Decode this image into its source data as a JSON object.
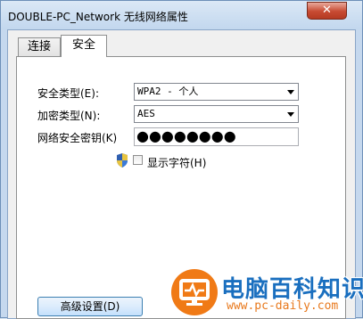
{
  "window": {
    "title": "DOUBLE-PC_Network 无线网络属性",
    "close_symbol": "✕"
  },
  "tabs": [
    {
      "label": "连接",
      "selected": false
    },
    {
      "label": "安全",
      "selected": true
    }
  ],
  "security": {
    "type_label": "安全类型(E):",
    "type_value": "WPA2 - 个人",
    "encryption_label": "加密类型(N):",
    "encryption_value": "AES",
    "key_label": "网络安全密钥(K)",
    "key_value": "●●●●●●●●",
    "show_chars_label": "显示字符(H)",
    "show_chars_checked": false
  },
  "buttons": {
    "advanced_label": "高级设置(D)"
  },
  "watermark": {
    "brand": "电脑百科知识",
    "url": "www.pc-daily.com",
    "color": "#1a6fbf",
    "accent": "#f07a16"
  },
  "icons": {
    "shield": "uac-shield-icon",
    "dropdown": "chevron-down-icon"
  }
}
